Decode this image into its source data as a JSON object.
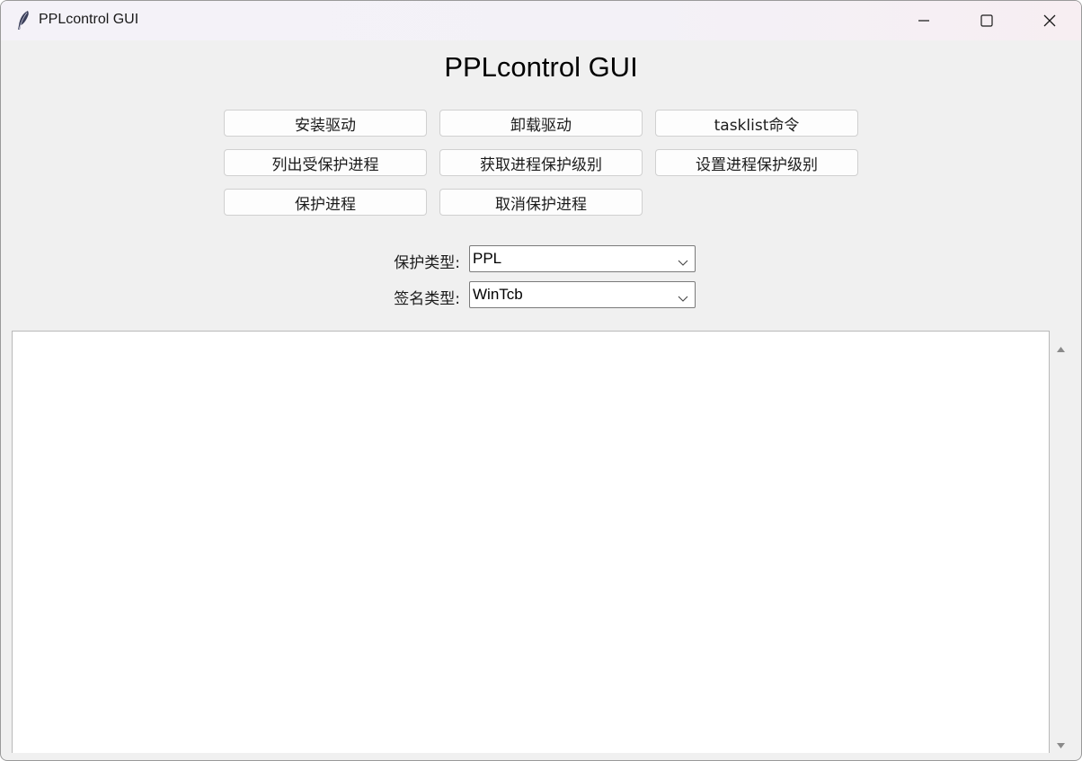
{
  "window": {
    "title": "PPLcontrol GUI",
    "icon": "feather-icon",
    "controls": [
      "minimize-icon",
      "maximize-icon",
      "close-icon"
    ]
  },
  "main": {
    "heading": "PPLcontrol GUI",
    "buttons": {
      "install_driver": "安装驱动",
      "uninstall_driver": "卸载驱动",
      "tasklist_command": "tasklist命令",
      "list_protected": "列出受保护进程",
      "get_protection_level": "获取进程保护级别",
      "set_protection_level": "设置进程保护级别",
      "protect_process": "保护进程",
      "unprotect_process": "取消保护进程"
    },
    "protection_type": {
      "label": "保护类型:",
      "value": "PPL"
    },
    "signer_type": {
      "label": "签名类型:",
      "value": "WinTcb"
    },
    "output": {
      "text": ""
    }
  },
  "colors": {
    "window_bg": "#f0f0f0",
    "button_bg": "#fdfdfd",
    "output_bg": "#ffffff"
  }
}
